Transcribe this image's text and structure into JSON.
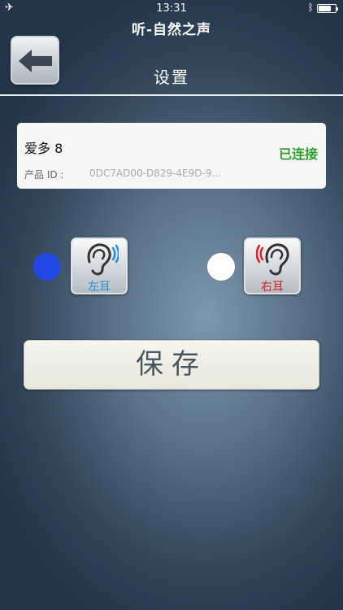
{
  "status_bar": {
    "time": "13:31",
    "airplane_icon": "airplane-icon",
    "bluetooth_icon": "bluetooth-icon",
    "battery_level": 0.75
  },
  "app": {
    "title": "听-自然之声"
  },
  "header": {
    "back_icon": "left-arrow-icon",
    "title": "设置"
  },
  "device": {
    "name": "爱多 8",
    "status": "已连接",
    "status_color": "#2f9e2f",
    "id_label": "产品 ID :",
    "id_value": "0DC7AD00-D829-4E9D-9..."
  },
  "ears": {
    "left": {
      "label": "左耳",
      "selected": true,
      "indicator_color": "#2348e6",
      "icon": "left-ear-icon"
    },
    "right": {
      "label": "右耳",
      "selected": false,
      "indicator_color": "#ffffff",
      "icon": "right-ear-icon"
    }
  },
  "save": {
    "label": "保存"
  }
}
